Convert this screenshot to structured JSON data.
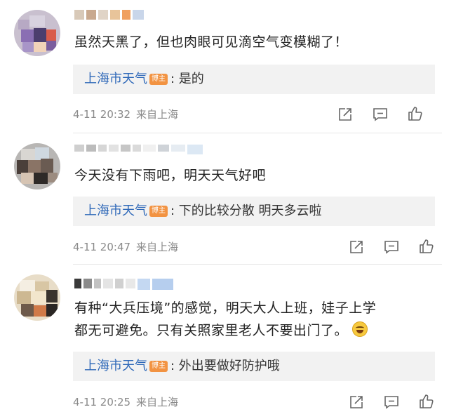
{
  "comments": [
    {
      "text": "虽然天黑了，但也肉眼可见滴空气变模糊了！",
      "reply": {
        "author": "上海市天气",
        "badge": "博主",
        "text": ": 是的"
      },
      "time": "4-11 20:32",
      "location": "来自上海"
    },
    {
      "text": "今天没有下雨吧，明天天气好吧",
      "reply": {
        "author": "上海市天气",
        "badge": "博主",
        "text": ": 下的比较分散 明天多云啦"
      },
      "time": "4-11 20:47",
      "location": "来自上海"
    },
    {
      "text_line1": "有种“大兵压境”的感觉，明天大人上班，娃子上学",
      "text_line2": "都无可避免。只有关照家里老人不要出门了。",
      "emoji": "laughing-crying-emoji",
      "reply": {
        "author": "上海市天气",
        "badge": "博主",
        "text": ": 外出要做好防护哦"
      },
      "time": "4-11 20:25",
      "location": "来自上海"
    }
  ],
  "icons": [
    "share-icon",
    "comment-icon",
    "like-icon"
  ],
  "colors": {
    "author_blue": "#2e68b8",
    "badge_orange": "#f29342",
    "meta_gray": "#8a8a8a"
  }
}
